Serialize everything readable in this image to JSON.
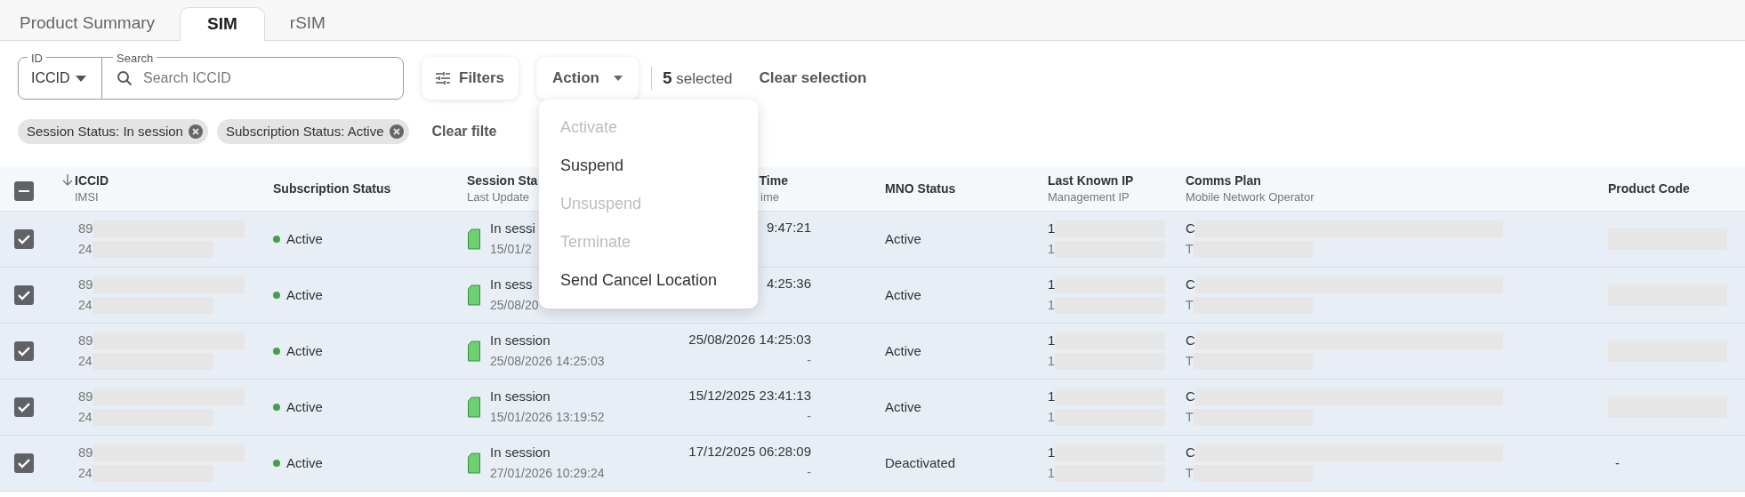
{
  "tabs": [
    {
      "label": "Product Summary",
      "selected": false
    },
    {
      "label": "SIM",
      "selected": true
    },
    {
      "label": "rSIM",
      "selected": false
    }
  ],
  "toolbar": {
    "id_label": "ID",
    "id_value": "ICCID",
    "search_label": "Search",
    "search_placeholder": "Search ICCID",
    "filters": "Filters",
    "action": "Action",
    "selected_count": "5",
    "selected_text": "selected",
    "clear_selection": "Clear selection"
  },
  "chips": [
    {
      "label": "Session Status: In session"
    },
    {
      "label": "Subscription Status: Active"
    }
  ],
  "clear_filters": "Clear filte",
  "action_menu": [
    {
      "label": "Activate",
      "disabled": true
    },
    {
      "label": "Suspend",
      "disabled": false
    },
    {
      "label": "Unsuspend",
      "disabled": true
    },
    {
      "label": "Terminate",
      "disabled": true
    },
    {
      "label": "Send Cancel Location",
      "disabled": false
    }
  ],
  "table": {
    "select_all": {
      "indeterminate": true
    },
    "columns": [
      {
        "title": "ICCID",
        "subtitle": "IMSI",
        "sorted": true
      },
      {
        "title": "Subscription Status"
      },
      {
        "title": "Session Sta",
        "subtitle": "Last Update"
      },
      {
        "title": "Time",
        "subtitle": "ime"
      },
      {
        "title": "MNO Status"
      },
      {
        "title": "Last Known IP",
        "subtitle": "Management IP"
      },
      {
        "title": "Comms Plan",
        "subtitle": "Mobile Network Operator"
      },
      {
        "title": "Product Code"
      }
    ],
    "rows": [
      {
        "checked": true,
        "iccid": "89",
        "imsi": "24",
        "subscription": "Active",
        "color": "#43a047",
        "session": "In sessi",
        "last_update": "15/01/2",
        "connection": "9:47:21",
        "mno": "Active",
        "ip": "1",
        "mgmt_ip": "1",
        "comms": "C",
        "operator": "T"
      },
      {
        "checked": true,
        "iccid": "89",
        "imsi": "24",
        "subscription": "Active",
        "color": "#43a047",
        "session": "In sess",
        "last_update": "25/08/20",
        "connection": "4:25:36",
        "mno": "Active",
        "ip": "1",
        "mgmt_ip": "1",
        "comms": "C",
        "operator": "T"
      },
      {
        "checked": true,
        "iccid": "89",
        "imsi": "24",
        "subscription": "Active",
        "color": "#43a047",
        "session": "In session",
        "last_update": "25/08/2026 14:25:03",
        "connection": "25/08/2026 14:25:03",
        "connection_sub": "-",
        "mno": "Active",
        "ip": "1",
        "mgmt_ip": "1",
        "comms": "C",
        "operator": "T"
      },
      {
        "checked": true,
        "iccid": "89",
        "imsi": "24",
        "subscription": "Active",
        "color": "#43a047",
        "session": "In session",
        "last_update": "15/01/2026 13:19:52",
        "connection": "15/12/2025 23:41:13",
        "connection_sub": "-",
        "mno": "Active",
        "ip": "1",
        "mgmt_ip": "1",
        "comms": "C",
        "operator": "T"
      },
      {
        "checked": true,
        "iccid": "89",
        "imsi": "24",
        "subscription": "Active",
        "color": "#43a047",
        "session": "In session",
        "last_update": "27/01/2026 10:29:24",
        "connection": "17/12/2025 06:28:09",
        "connection_sub": "-",
        "mno": "Deactivated",
        "ip": "1",
        "mgmt_ip": "1",
        "comms": "C",
        "operator": "T",
        "product_code": "-"
      }
    ]
  }
}
